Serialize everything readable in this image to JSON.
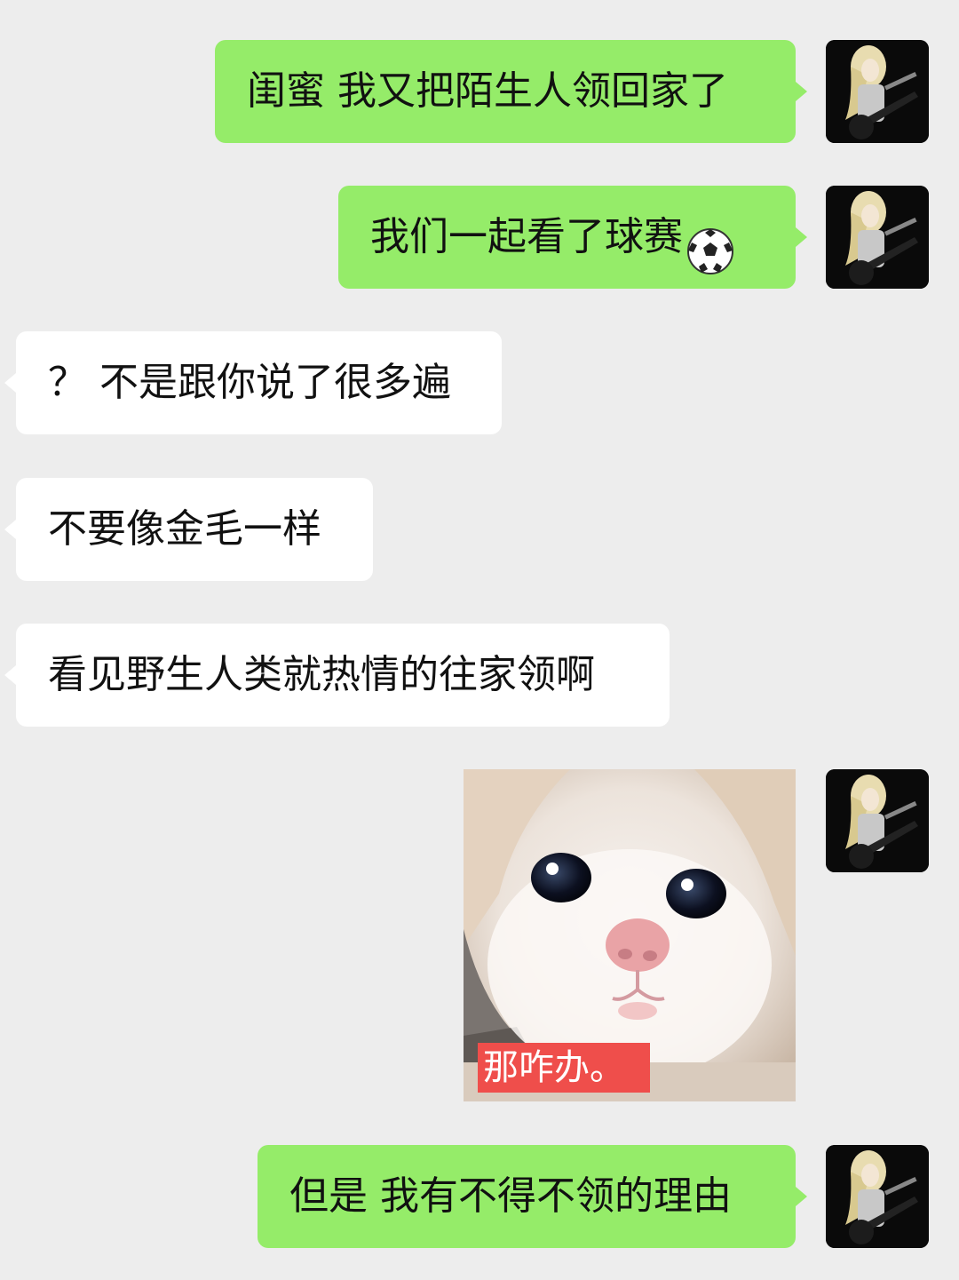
{
  "messages": [
    {
      "side": "right",
      "text": "闺蜜 我又把陌生人领回家了"
    },
    {
      "side": "right",
      "text": "我们一起看了球赛",
      "emoji": "soccer-ball-icon"
    },
    {
      "side": "left",
      "text": "？ 不是跟你说了很多遍"
    },
    {
      "side": "left",
      "text": "不要像金毛一样"
    },
    {
      "side": "left",
      "text": "看见野生人类就热情的往家领啊"
    },
    {
      "side": "right",
      "type": "sticker",
      "caption": "那咋办。"
    },
    {
      "side": "right",
      "text": "但是 我有不得不领的理由"
    }
  ],
  "colors": {
    "background": "#ededed",
    "outgoing_bubble": "#95ec69",
    "incoming_bubble": "#ffffff",
    "sticker_caption": "#ef4e4b"
  }
}
